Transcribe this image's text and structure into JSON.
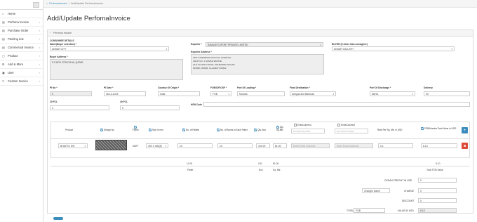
{
  "sidebar": {
    "items": [
      {
        "icon": "home-icon",
        "label": "Home",
        "chev": ""
      },
      {
        "icon": "document-icon",
        "label": "Perfoma Invoice",
        "chev": "‹"
      },
      {
        "icon": "cart-icon",
        "label": "Purchase Order",
        "chev": "‹"
      },
      {
        "icon": "list-icon",
        "label": "Packing List",
        "chev": "‹"
      },
      {
        "icon": "invoice-icon",
        "label": "Commercial Invoice",
        "chev": "‹"
      },
      {
        "icon": "box-icon",
        "label": "Product",
        "chev": "‹"
      },
      {
        "icon": "plus-icon",
        "label": "Add & More",
        "chev": "‹"
      },
      {
        "icon": "user-icon",
        "label": "User",
        "chev": "‹"
      },
      {
        "icon": "edit-icon",
        "label": "Custom Invoice",
        "chev": "‹"
      }
    ]
  },
  "breadcrumb": {
    "home": "⌂",
    "link": "Performainvoice",
    "sep": "/",
    "current": "Add/Update Performainvoice"
  },
  "page_title": "Add/Update PerfomaInvoice",
  "panel_title": "Perfoma Invoice",
  "consignee": {
    "section": "CONSIGNEE DETAILS",
    "name_label": "Name(Buyer selection) *",
    "name_value": "ANSAR CITY",
    "address_label": "Buyer Address *",
    "address_value": "P.O BOX 3726 DOHA, QATAR"
  },
  "exporter": {
    "label": "Exporter *",
    "value": "SAVAGE EXPORT PRIVATE LIMITED",
    "address_label": "Exporter Address *",
    "address_lines": "OPP. KAMARPAN MULTI SP. HOSPITAL\nSHOP NO. 1 SOMAR ESTATE\nOLD GHUNTU ROAD, MAHENDRA NAGAR\nMORBI, MORBI, GUJARAT 363642"
  },
  "buyer_other": {
    "label": "BUYER (if other than consignee)",
    "value": "ANSAR GALLERY"
  },
  "fields": {
    "pi_no_label": "PI No *",
    "pi_no": "0",
    "pi_date_label": "PI Date *",
    "pi_date": "06-10-2023",
    "origin_label": "Country Of Origin *",
    "origin": "India",
    "fob_label": "FOB/CIF/CNF *",
    "fob": "FOB",
    "loading_label": "Port Of Loading *",
    "loading": "Mundra",
    "final_label": "Final Destination *",
    "final": "Antigua and Barbuda",
    "discharge_label": "Port Of Discharge *",
    "discharge": "ABHA",
    "delivery_label": "Delivery",
    "delivery": "30",
    "fcl1_label": "20 FCL",
    "fcl1": "4",
    "fcl2_label": "40 FCL",
    "fcl2": "5",
    "hsn_label": "HSN Code"
  },
  "table": {
    "headers": {
      "product": "Product",
      "design": "Design No",
      "finish": "Finish",
      "size": "Size in mm",
      "pallets": "No. of Pallets",
      "boxes": "No. of Boxes in Each Pallet",
      "qty_box": "Qty. Box",
      "qty_sqmtr": "Qty. Sq.Mtr.",
      "extra1": "ExtraColumn1",
      "extra1_ph": "EXTRACOLUMN1",
      "extra2": "ExtraColumn2",
      "extra2_ph": "EXTRACOLUMN2",
      "rate": "Rate Per Sq. Mtr. in USD",
      "fob_total": "FOB/Mundra Total Value in USD"
    },
    "row": {
      "product": "BHAVYO EW",
      "finish": "MATT",
      "size": "300 X 450(8)",
      "pallets": "10",
      "boxes": "10",
      "qty_box": "100.00",
      "qty_sqmtr": "81.00",
      "extra1_ph": "Enter Extra Column1",
      "extra2_ph": "Enter Extra Column2",
      "rate": "0.1",
      "fob_total": "8.10"
    },
    "sum1": {
      "pallets": "10.00",
      "qty_box": "100",
      "qty_sqmtr": "81.00",
      "fob": "8.10"
    },
    "sum2": {
      "pallets": "Pallet",
      "qty_box": "Box",
      "qty_sqmtr": "Sq. Mtr.",
      "fob": "Total FOB Value"
    }
  },
  "totals": {
    "ocean_label": "OCEAN FREIGHT IN USD",
    "ocean": "0",
    "charge_name": "Charges Name",
    "charge_label": "CHARGE",
    "charge": "0",
    "discount_label": "DISCOUNT",
    "discount": "0",
    "total_label": "TOTAL",
    "total_mode": "FOB",
    "value_label": "VALUE IN USD",
    "value": "8.10"
  },
  "colors": {
    "accent": "#3c8dbc",
    "danger": "#dd4b39"
  }
}
